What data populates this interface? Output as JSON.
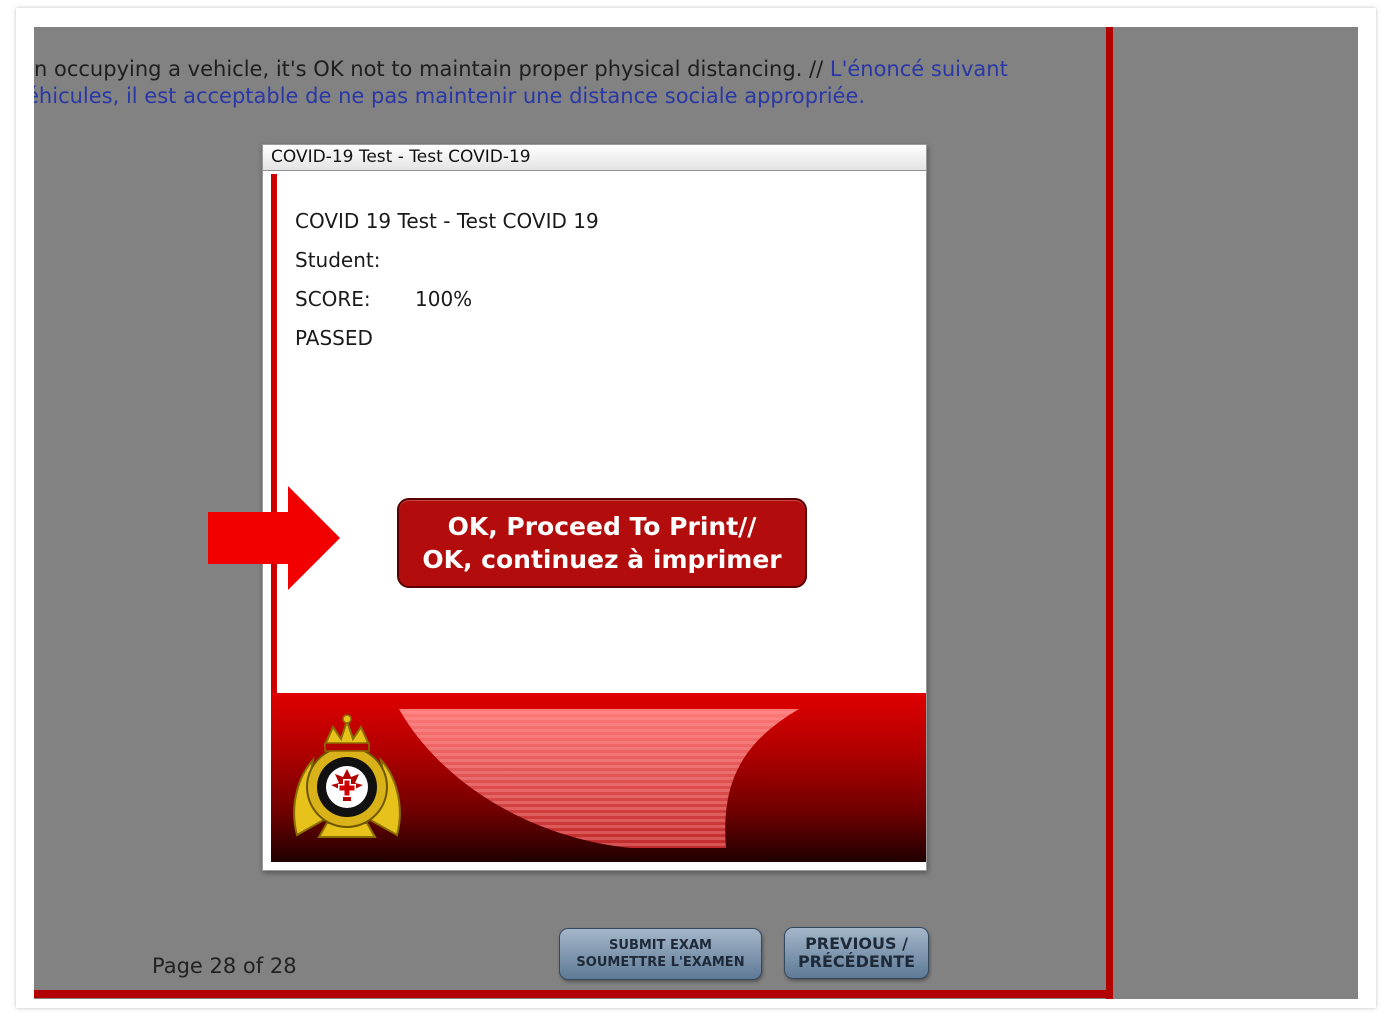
{
  "question": {
    "line1_en": "n occupying a vehicle, it's OK not to maintain proper physical distancing. // ",
    "line1_fr": "L'énoncé suivant",
    "line2_fr": "éhicules, il est acceptable de ne pas maintenir une distance sociale appropriée."
  },
  "dialog": {
    "title": "COVID-19 Test - Test COVID-19",
    "test_name": "COVID 19 Test - Test COVID 19",
    "student_label": "Student:",
    "student_value": "",
    "score_label": "SCORE:",
    "score_value": "100%",
    "result": "PASSED",
    "proceed_line1": "OK, Proceed To Print//",
    "proceed_line2": "OK, continuez à imprimer"
  },
  "footer": {
    "page_label": "Page 28 of 28",
    "submit_line1": "SUBMIT EXAM",
    "submit_line2": "SOUMETTRE L'EXAMEN",
    "previous_line1": "PREVIOUS /",
    "previous_line2": "PRÉCÉDENTE"
  },
  "colors": {
    "background_gray": "#828282",
    "accent_red": "#b30000",
    "french_text": "#2a37a6",
    "button_blue": "#6f88a3"
  },
  "icons": {
    "pointer": "red-arrow-icon",
    "crest": "cf-health-services-crest-icon"
  }
}
